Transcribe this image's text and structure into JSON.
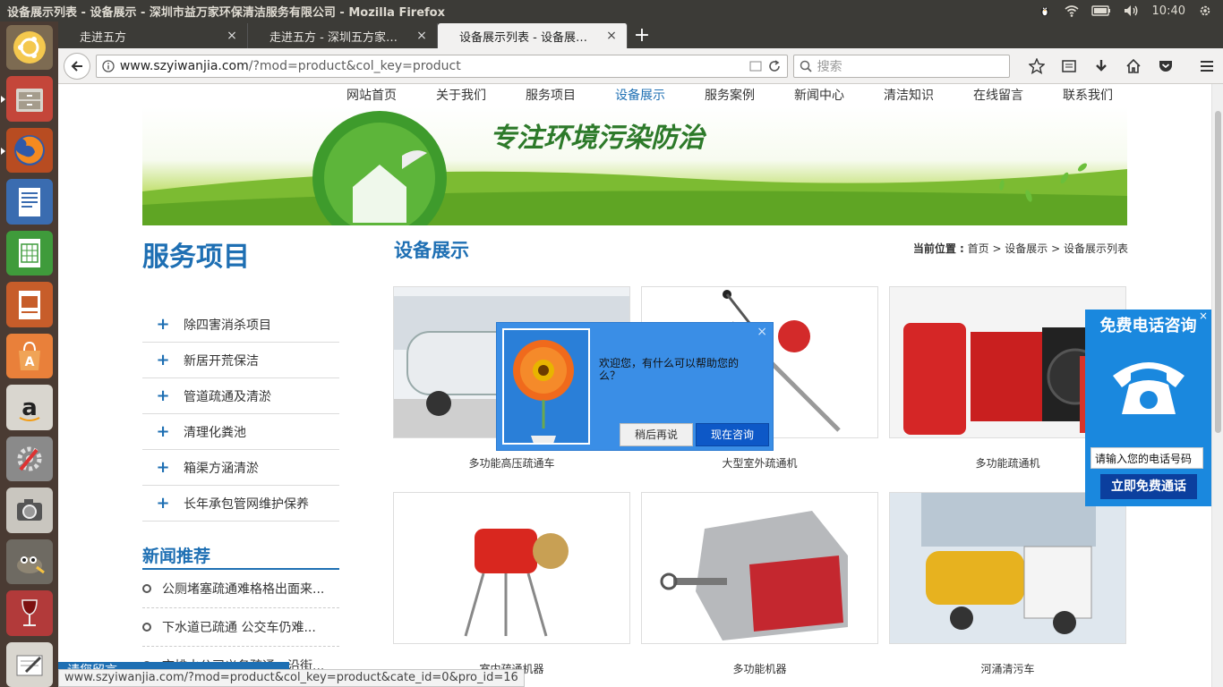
{
  "os": {
    "window_title": "设备展示列表 - 设备展示 - 深圳市益万家环保清洁服务有限公司 - Mozilla Firefox",
    "clock": "10:40"
  },
  "launcher": {
    "items": [
      {
        "name": "ubuntu-dash-icon"
      },
      {
        "name": "files-icon"
      },
      {
        "name": "firefox-icon"
      },
      {
        "name": "writer-icon"
      },
      {
        "name": "calc-icon"
      },
      {
        "name": "impress-icon"
      },
      {
        "name": "software-center-icon"
      },
      {
        "name": "amazon-icon"
      },
      {
        "name": "system-settings-icon"
      },
      {
        "name": "camera-icon"
      },
      {
        "name": "gimp-icon"
      },
      {
        "name": "wine-icon"
      },
      {
        "name": "text-editor-icon"
      }
    ]
  },
  "browser": {
    "tabs": [
      {
        "label": "走进五方",
        "close": "×"
      },
      {
        "label": "走进五方 - 深圳五方家…",
        "close": "×"
      },
      {
        "label": "设备展示列表 - 设备展…",
        "close": "×"
      }
    ],
    "new_tab": "+",
    "url_host": "www.szyiwanjia.com",
    "url_path": "/?mod=product&col_key=product",
    "search_placeholder": "搜索",
    "status_url": "www.szyiwanjia.com/?mod=product&col_key=product&cate_id=0&pro_id=16"
  },
  "site": {
    "nav": [
      "网站首页",
      "关于我们",
      "服务项目",
      "设备展示",
      "服务案例",
      "新闻中心",
      "清洁知识",
      "在线留言",
      "联系我们"
    ],
    "banner_slogan": "专注环境污染防治",
    "services_title": "服务项目",
    "services": [
      "除四害消杀项目",
      "新居开荒保洁",
      "管道疏通及清淤",
      "清理化粪池",
      "箱渠方涵清淤",
      "长年承包管网维护保养"
    ],
    "news_title": "新闻推荐",
    "news": [
      "公厕堵塞疏通难格格出面来...",
      "下水道已疏通 公交车仍难...",
      "市排水公司义务疏通一沿街..."
    ],
    "main_title": "设备展示",
    "crumb_label": "当前位置 :",
    "crumb_path": " 首页 > 设备展示 > 设备展示列表",
    "products": [
      "多功能高压疏通车",
      "大型室外疏通机",
      "多功能疏通机",
      "室内疏通机器",
      "多功能机器",
      "河涌清污车"
    ],
    "chat": {
      "message": "欢迎您，有什么可以帮助您的么？",
      "later": "稍后再说",
      "now": "现在咨询",
      "close": "×"
    },
    "freecall": {
      "title": "免费电话咨询",
      "input_placeholder": "请输入您的电话号码",
      "button": "立即免费通话",
      "close": "×"
    },
    "side_close": "×",
    "leave_message": "请您留言"
  }
}
